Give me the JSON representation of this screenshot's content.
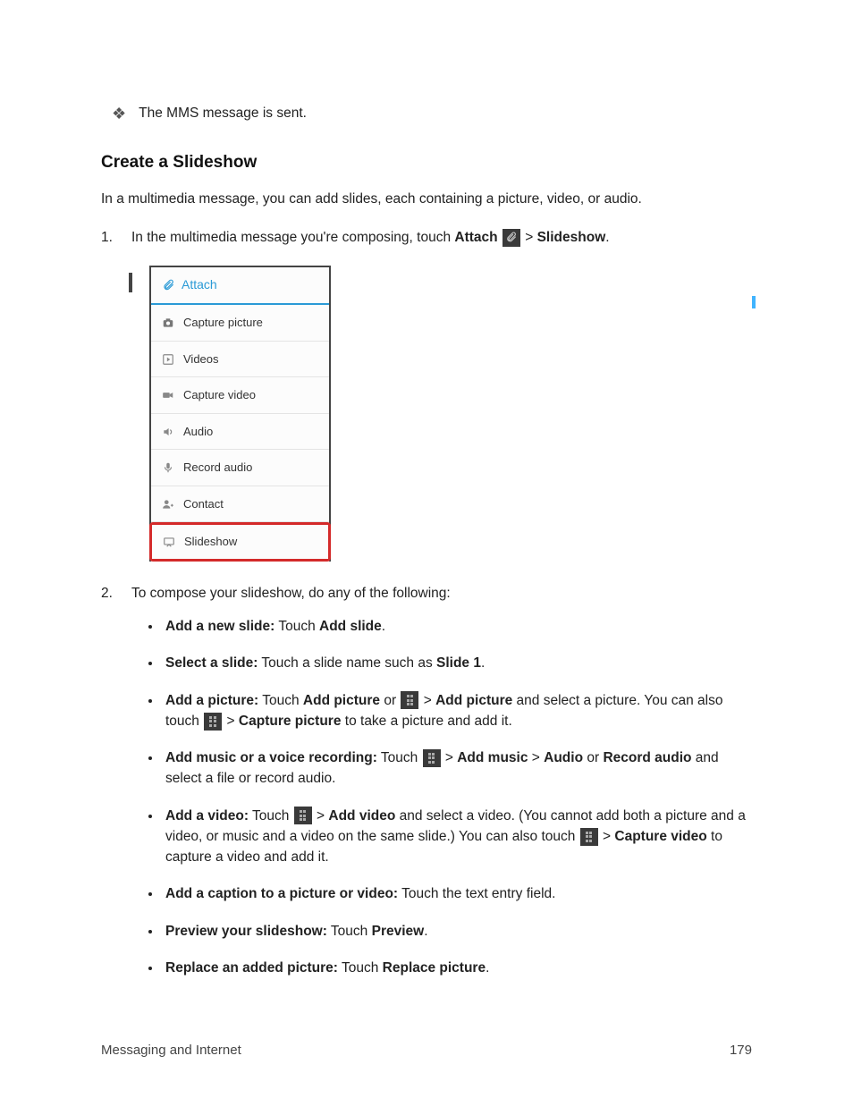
{
  "top_bullet": "The MMS message is sent.",
  "heading": "Create a Slideshow",
  "intro": "In a multimedia message, you can add slides, each containing a picture, video, or audio.",
  "step1": {
    "a": "In the multimedia message you're composing, touch ",
    "attach": "Attach",
    "gt": " > ",
    "slideshow": "Slideshow",
    "dot": "."
  },
  "menu": {
    "header": "Attach",
    "items": {
      "capture_picture": "Capture picture",
      "videos": "Videos",
      "capture_video": "Capture video",
      "audio": "Audio",
      "record_audio": "Record audio",
      "contact": "Contact",
      "slideshow": "Slideshow"
    }
  },
  "step2": "To compose your slideshow, do any of the following:",
  "sub": {
    "b1": {
      "label": "Add a new slide:",
      "a": " Touch ",
      "b": "Add slide",
      "c": "."
    },
    "b2": {
      "label": "Select a slide:",
      "a": " Touch a slide name such as ",
      "b": "Slide 1",
      "c": "."
    },
    "b3": {
      "label": "Add a picture:",
      "a": " Touch ",
      "b": "Add picture",
      "c": " or ",
      "gt": " > ",
      "d": "Add picture",
      "e": " and select a picture. You can also touch ",
      "f": "Capture picture",
      "g": " to take a picture and add it."
    },
    "b4": {
      "label": "Add music or a voice recording:",
      "a": " Touch ",
      "gt": " > ",
      "b": "Add music",
      "gt2": " > ",
      "c": "Audio",
      "or": " or ",
      "d": "Record audio",
      "e": " and select a file or record audio."
    },
    "b5": {
      "label": "Add a video:",
      "a": " Touch ",
      "gt": " > ",
      "b": "Add video",
      "c": " and select a video. (You cannot add both a picture and a video, or music and a video on the same slide.) You can also touch ",
      "d": "Capture video",
      "e": " to capture a video and add it."
    },
    "b6": {
      "label": "Add a caption to a picture or video:",
      "a": " Touch the text entry field."
    },
    "b7": {
      "label": "Preview your slideshow:",
      "a": " Touch ",
      "b": "Preview",
      "c": "."
    },
    "b8": {
      "label": "Replace an added picture:",
      "a": " Touch ",
      "b": "Replace picture",
      "c": "."
    }
  },
  "footer": {
    "left": "Messaging and Internet",
    "right": "179"
  }
}
